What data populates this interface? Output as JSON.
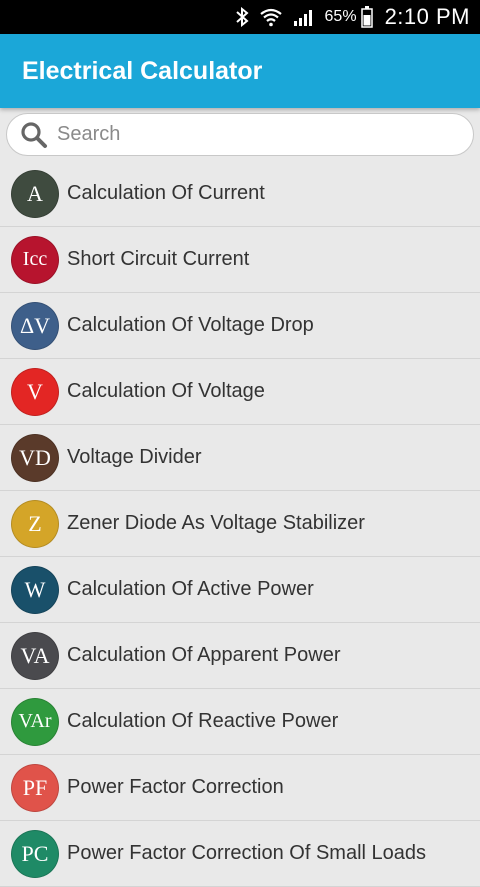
{
  "status_bar": {
    "icons": [
      "bluetooth-icon",
      "wifi-icon",
      "signal-icon",
      "battery-icon"
    ],
    "battery_percent": "65%",
    "time": "2:10 PM"
  },
  "app_bar": {
    "title": "Electrical Calculator"
  },
  "search": {
    "placeholder": "Search",
    "value": ""
  },
  "items": [
    {
      "abbr": "A",
      "label": "Calculation Of Current",
      "color": "#3f4b3f"
    },
    {
      "abbr": "Icc",
      "label": "Short Circuit Current",
      "color": "#b7142e"
    },
    {
      "abbr": "ΔV",
      "label": "Calculation Of Voltage Drop",
      "color": "#3e5f8a"
    },
    {
      "abbr": "V",
      "label": "Calculation Of Voltage",
      "color": "#e32624"
    },
    {
      "abbr": "VD",
      "label": "Voltage Divider",
      "color": "#5a3a2a"
    },
    {
      "abbr": "Z",
      "label": "Zener Diode As Voltage Stabilizer",
      "color": "#d4a528"
    },
    {
      "abbr": "W",
      "label": "Calculation Of Active Power",
      "color": "#19506a"
    },
    {
      "abbr": "VA",
      "label": "Calculation Of Apparent Power",
      "color": "#4a4a4e"
    },
    {
      "abbr": "VAr",
      "label": "Calculation Of Reactive Power",
      "color": "#2f9a3e"
    },
    {
      "abbr": "PF",
      "label": "Power Factor Correction",
      "color": "#e0534a"
    },
    {
      "abbr": "PC",
      "label": "Power Factor Correction Of Small Loads",
      "color": "#1f8a66"
    }
  ]
}
